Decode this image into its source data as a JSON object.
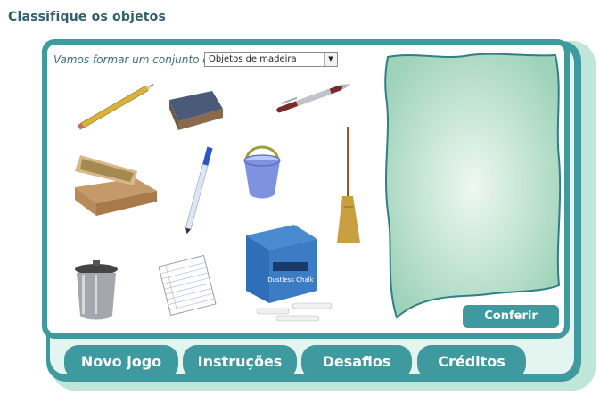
{
  "page": {
    "title": "Classifique os objetos"
  },
  "controls": {
    "prompt": "Vamos formar um conjunto de",
    "select_value": "Objetos de madeira"
  },
  "objects": [
    {
      "name": "pencil"
    },
    {
      "name": "eraser"
    },
    {
      "name": "pen"
    },
    {
      "name": "sandpaper-block"
    },
    {
      "name": "ballpoint-pen"
    },
    {
      "name": "plastic-bucket"
    },
    {
      "name": "broom"
    },
    {
      "name": "metal-trash-can"
    },
    {
      "name": "notebook-paper"
    },
    {
      "name": "chalk-box"
    }
  ],
  "chalk_box": {
    "brand": "Dustless Chalk"
  },
  "buttons": {
    "conferir": "Conferir"
  },
  "tabs": [
    "Novo jogo",
    "Instruções",
    "Desafios",
    "Créditos"
  ],
  "colors": {
    "teal": "#3f9aa0",
    "light_green": "#bfe6d8",
    "set_area": "#c9ead8",
    "title": "#2f5f6b"
  }
}
